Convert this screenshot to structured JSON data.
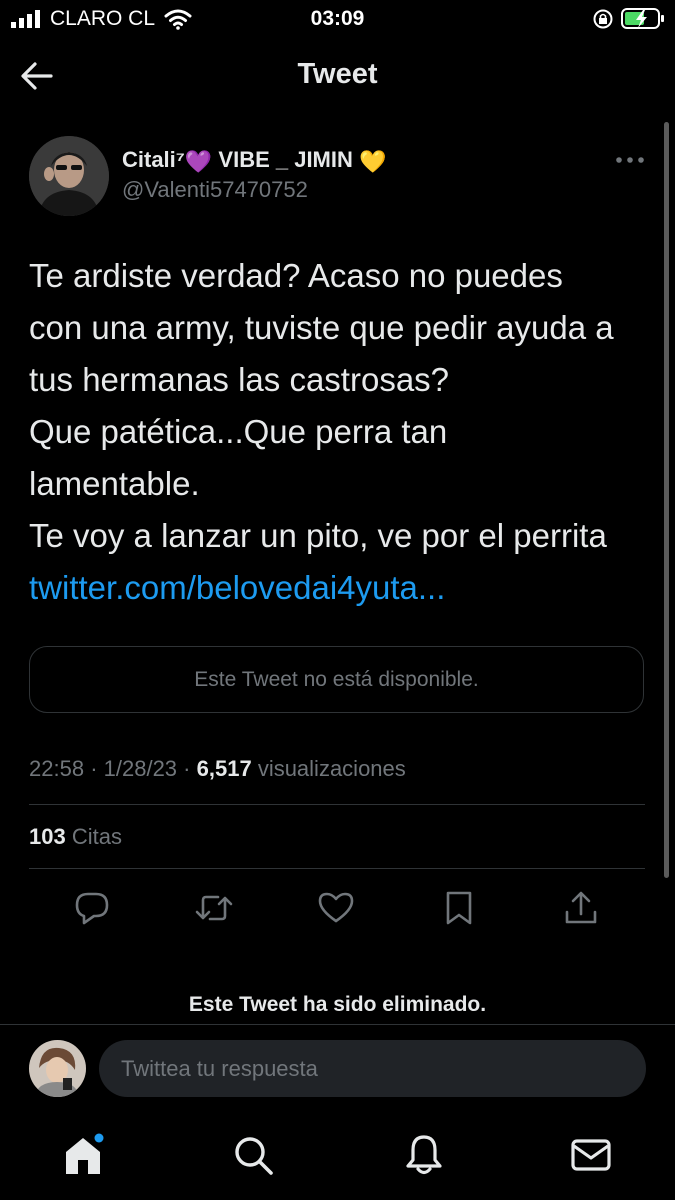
{
  "status_bar": {
    "carrier": "CLARO CL",
    "time": "03:09"
  },
  "nav": {
    "title": "Tweet",
    "back_icon": "arrow-left-icon"
  },
  "author": {
    "display_name": "Citali⁷",
    "display_name_suffix": "VIBE _ JIMIN",
    "emoji_1": "💜",
    "emoji_2": "💛",
    "handle": "@Valenti57470752"
  },
  "tweet": {
    "lines": [
      "Te ardiste verdad? Acaso no puedes",
      "con una army, tuviste que pedir ayuda a",
      "tus hermanas las castrosas?",
      "Que patética...Que perra tan",
      "lamentable.",
      "Te voy a lanzar un pito, ve por el perrita"
    ],
    "link": "twitter.com/belovedai4yuta..."
  },
  "quote": {
    "text": "Este Tweet no está disponible."
  },
  "meta": {
    "time": "22:58",
    "sep1": "·",
    "date": "1/28/23",
    "sep2": "·",
    "views": "6,517",
    "views_label": "visualizaciones"
  },
  "stats": {
    "quotes_count": "103",
    "quotes_label": "Citas"
  },
  "actions": [
    "reply-icon",
    "retweet-icon",
    "like-icon",
    "bookmark-icon",
    "share-icon"
  ],
  "deleted_notice": "Este Tweet ha sido eliminado.",
  "reply": {
    "placeholder": "Twittea tu respuesta"
  },
  "tab_bar": {
    "items": [
      "home-icon",
      "search-icon",
      "notifications-icon",
      "messages-icon"
    ],
    "badge_color": "#1d9bf0"
  },
  "colors": {
    "background": "#000000",
    "text": "#e7e9ea",
    "secondary": "#71767b",
    "link": "#1d9bf0",
    "battery": "#4cd964"
  }
}
